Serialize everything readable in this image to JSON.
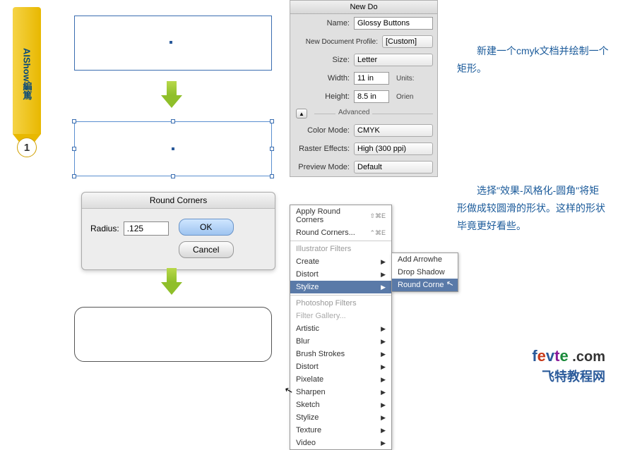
{
  "banner": {
    "text": "AIShow編篤",
    "step": "1"
  },
  "newdoc": {
    "title": "New Do",
    "name_label": "Name:",
    "name_value": "Glossy Buttons",
    "profile_label": "New Document Profile:",
    "profile_value": "[Custom]",
    "size_label": "Size:",
    "size_value": "Letter",
    "width_label": "Width:",
    "width_value": "11 in",
    "units_label": "Units:",
    "height_label": "Height:",
    "height_value": "8.5 in",
    "orient_label": "Orien",
    "advanced_label": "Advanced",
    "colormode_label": "Color Mode:",
    "colormode_value": "CMYK",
    "raster_label": "Raster Effects:",
    "raster_value": "High (300 ppi)",
    "preview_label": "Preview Mode:",
    "preview_value": "Default"
  },
  "rc": {
    "title": "Round Corners",
    "radius_label": "Radius:",
    "radius_value": ".125",
    "ok": "OK",
    "cancel": "Cancel"
  },
  "menu": {
    "apply": "Apply Round Corners",
    "apply_sc": "⇧⌘E",
    "edit": "Round Corners...",
    "edit_sc": "⌃⌘E",
    "ill_header": "Illustrator Filters",
    "create": "Create",
    "distort": "Distort",
    "stylize": "Stylize",
    "ps_header": "Photoshop Filters",
    "gallery": "Filter Gallery...",
    "artistic": "Artistic",
    "blur": "Blur",
    "brush": "Brush Strokes",
    "distort2": "Distort",
    "pixelate": "Pixelate",
    "sharpen": "Sharpen",
    "sketch": "Sketch",
    "stylize2": "Stylize",
    "texture": "Texture",
    "video": "Video"
  },
  "submenu": {
    "arrow": "Add Arrowhe",
    "drop": "Drop Shadow",
    "round": "Round Corne"
  },
  "instructions": {
    "para1": "新建一个cmyk文档并绘制一个矩形。",
    "para2": "选择\"效果-风格化-圆角\"将矩形做成较圆滑的形状。这样的形状毕竟更好看些。"
  },
  "logo": {
    "sub": "飞特教程网",
    "com": " .com"
  }
}
